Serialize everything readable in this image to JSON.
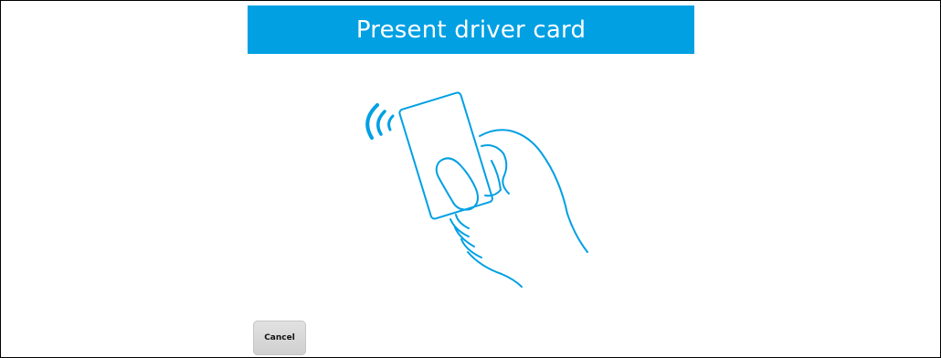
{
  "header": {
    "title": "Present driver card"
  },
  "illustration": {
    "icon": "hand-presenting-contactless-card-icon",
    "color": "#00a0e3"
  },
  "actions": {
    "cancel_label": "Cancel"
  },
  "colors": {
    "accent": "#00a0e3",
    "title_text": "#ffffff",
    "button_bg": "#d6d6d6",
    "background": "#ffffff"
  }
}
